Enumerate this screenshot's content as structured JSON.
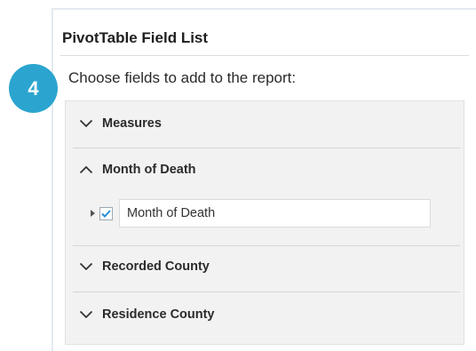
{
  "panel": {
    "title": "PivotTable Field List",
    "prompt": "Choose fields to add to the report:"
  },
  "step_badge": "4",
  "sections": [
    {
      "label": "Measures",
      "expanded": false,
      "icon": "chevron-down-icon"
    },
    {
      "label": "Month of Death",
      "expanded": true,
      "icon": "chevron-up-icon",
      "fields": [
        {
          "label": "Month of Death",
          "checked": true
        }
      ]
    },
    {
      "label": "Recorded County",
      "expanded": false,
      "icon": "chevron-down-icon"
    },
    {
      "label": "Residence County",
      "expanded": false,
      "icon": "chevron-down-icon"
    }
  ],
  "colors": {
    "badge": "#2ba5cf",
    "checkmark": "#2b8fd6",
    "list_background": "#f2f2f2"
  }
}
